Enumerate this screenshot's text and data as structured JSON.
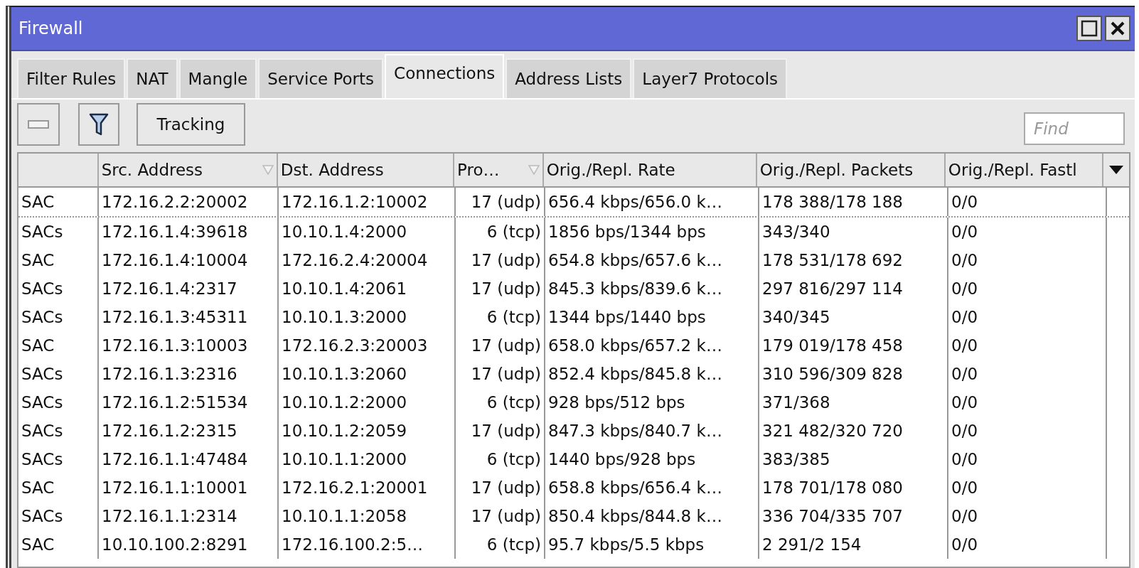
{
  "window": {
    "title": "Firewall"
  },
  "tabs": [
    {
      "label": "Filter Rules",
      "selected": false
    },
    {
      "label": "NAT",
      "selected": false
    },
    {
      "label": "Mangle",
      "selected": false
    },
    {
      "label": "Service Ports",
      "selected": false
    },
    {
      "label": "Connections",
      "selected": true
    },
    {
      "label": "Address Lists",
      "selected": false
    },
    {
      "label": "Layer7 Protocols",
      "selected": false
    }
  ],
  "toolbar": {
    "tracking_button": "Tracking",
    "search": {
      "placeholder": "Find"
    }
  },
  "table": {
    "columns": [
      {
        "sorted": false
      },
      {
        "label": "Src. Address",
        "sorted": true
      },
      {
        "label": "Dst. Address",
        "sorted": false
      },
      {
        "label": "Pro…",
        "sorted": true
      },
      {
        "label": "Orig./Repl. Rate",
        "sorted": false
      },
      {
        "label": "Orig./Repl. Packets",
        "sorted": false
      },
      {
        "label": "Orig./Repl. Fastl",
        "sorted": false
      }
    ],
    "rows": [
      [
        "SAC",
        "172.16.2.2:20002",
        "172.16.1.2:10002",
        "17 (udp)",
        "656.4 kbps/656.0 k…",
        "178 388/178 188",
        "0/0"
      ],
      [
        "SACs",
        "172.16.1.4:39618",
        "10.10.1.4:2000",
        "6 (tcp)",
        "1856 bps/1344 bps",
        "343/340",
        "0/0"
      ],
      [
        "SAC",
        "172.16.1.4:10004",
        "172.16.2.4:20004",
        "17 (udp)",
        "654.8 kbps/657.6 k…",
        "178 531/178 692",
        "0/0"
      ],
      [
        "SACs",
        "172.16.1.4:2317",
        "10.10.1.4:2061",
        "17 (udp)",
        "845.3 kbps/839.6 k…",
        "297 816/297 114",
        "0/0"
      ],
      [
        "SACs",
        "172.16.1.3:45311",
        "10.10.1.3:2000",
        "6 (tcp)",
        "1344 bps/1440 bps",
        "340/345",
        "0/0"
      ],
      [
        "SAC",
        "172.16.1.3:10003",
        "172.16.2.3:20003",
        "17 (udp)",
        "658.0 kbps/657.2 k…",
        "179 019/178 458",
        "0/0"
      ],
      [
        "SACs",
        "172.16.1.3:2316",
        "10.10.1.3:2060",
        "17 (udp)",
        "852.4 kbps/845.8 k…",
        "310 596/309 828",
        "0/0"
      ],
      [
        "SACs",
        "172.16.1.2:51534",
        "10.10.1.2:2000",
        "6 (tcp)",
        "928 bps/512 bps",
        "371/368",
        "0/0"
      ],
      [
        "SACs",
        "172.16.1.2:2315",
        "10.10.1.2:2059",
        "17 (udp)",
        "847.3 kbps/840.7 k…",
        "321 482/320 720",
        "0/0"
      ],
      [
        "SACs",
        "172.16.1.1:47484",
        "10.10.1.1:2000",
        "6 (tcp)",
        "1440 bps/928 bps",
        "383/385",
        "0/0"
      ],
      [
        "SAC",
        "172.16.1.1:10001",
        "172.16.2.1:20001",
        "17 (udp)",
        "658.8 kbps/656.4 k…",
        "178 701/178 080",
        "0/0"
      ],
      [
        "SACs",
        "172.16.1.1:2314",
        "10.10.1.1:2058",
        "17 (udp)",
        "850.4 kbps/844.8 k…",
        "336 704/335 707",
        "0/0"
      ],
      [
        "SAC",
        "10.10.100.2:8291",
        "172.16.100.2:5…",
        "6 (tcp)",
        "95.7 kbps/5.5 kbps",
        "2 291/2 154",
        "0/0"
      ]
    ]
  }
}
